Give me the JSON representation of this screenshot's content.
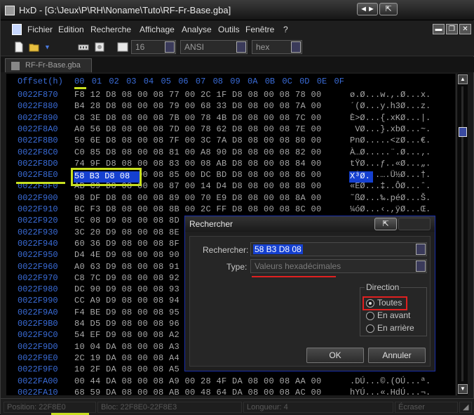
{
  "window": {
    "title": "HxD - [G:\\Jeux\\P\\RH\\Noname\\Tuto\\RF-Fr-Base.gba]",
    "restore_glyph": "◄►",
    "close_glyph": "⇱"
  },
  "menu": {
    "items": [
      "Fichier",
      "Edition",
      "Recherche",
      "Affichage",
      "Analyse",
      "Outils",
      "Fenêtre",
      "?"
    ]
  },
  "toolbar": {
    "bytes_per_row": "16",
    "charset": "ANSI",
    "offset_base": "hex"
  },
  "tab": {
    "label": "RF-Fr-Base.gba"
  },
  "hex": {
    "offset_header": "Offset(h)",
    "columns": [
      "00",
      "01",
      "02",
      "03",
      "04",
      "05",
      "06",
      "07",
      "08",
      "09",
      "0A",
      "0B",
      "0C",
      "0D",
      "0E",
      "0F"
    ],
    "rows": [
      {
        "offset": "0022F870",
        "bytes": "F8 12 D8 08 00 08 77 00 2C 1F D8 08 00 08 78 00",
        "ascii": "ø.Ø...w.,.Ø...x."
      },
      {
        "offset": "0022F880",
        "bytes": "B4 28 D8 08 00 08 79 00 68 33 D8 08 00 08 7A 00",
        "ascii": "´(Ø...y.h3Ø...z."
      },
      {
        "offset": "0022F890",
        "bytes": "C8 3E D8 08 00 08 7B 00 78 4B D8 08 00 08 7C 00",
        "ascii": "È>Ø...{.xKØ...|."
      },
      {
        "offset": "0022F8A0",
        "bytes": "A0 56 D8 08 00 08 7D 00 78 62 D8 08 00 08 7E 00",
        "ascii": " VØ...}.xbØ...~."
      },
      {
        "offset": "0022F8B0",
        "bytes": "50 6E D8 08 00 08 7F 00 3C 7A D8 08 00 08 80 00",
        "ascii": "PnØ.....<zØ...€."
      },
      {
        "offset": "0022F8C0",
        "bytes": "C0 85 D8 08 00 08 81 00 A8 90 D8 08 00 08 82 00",
        "ascii": "À…Ø.....¨.Ø...‚."
      },
      {
        "offset": "0022F8D0",
        "bytes": "74 9F D8 08 00 08 83 00 08 AB D8 08 00 08 84 00",
        "ascii": "tŸØ...ƒ..«Ø...„."
      },
      {
        "offset": "0022F8E0",
        "bytes": "58 B3 D8 08 00 08 85 00 DC BD D8 08 00 08 86 00",
        "ascii": "X³Ø...….Ü½Ø...†."
      },
      {
        "offset": "0022F8F0",
        "bytes": "AB C9 D8 08 00 08 87 00 14 D4 D8 08 00 08 88 00",
        "ascii": "«ÉØ...‡..ÔØ...ˆ."
      },
      {
        "offset": "0022F900",
        "bytes": "98 DF D8 08 00 08 89 00 70 E9 D8 08 00 08 8A 00",
        "ascii": "˜ßØ...‰.péØ...Š."
      },
      {
        "offset": "0022F910",
        "bytes": "BC F3 D8 08 00 08 8B 00 2C FF D8 08 00 08 8C 00",
        "ascii": "¼óØ...‹.,ÿØ...Œ."
      },
      {
        "offset": "0022F920",
        "bytes": "5C 08 D9 08 00 08 8D 00",
        "ascii": ""
      },
      {
        "offset": "0022F930",
        "bytes": "3C 20 D9 08 00 08 8E 00",
        "ascii": ""
      },
      {
        "offset": "0022F940",
        "bytes": "60 36 D9 08 00 08 8F 00",
        "ascii": ""
      },
      {
        "offset": "0022F950",
        "bytes": "D4 4E D9 08 00 08 90 00",
        "ascii": ""
      },
      {
        "offset": "0022F960",
        "bytes": "A0 63 D9 08 00 08 91 00",
        "ascii": ""
      },
      {
        "offset": "0022F970",
        "bytes": "C8 7C D9 08 00 08 92 00",
        "ascii": ""
      },
      {
        "offset": "0022F980",
        "bytes": "DC 90 D9 08 00 08 93 00",
        "ascii": ""
      },
      {
        "offset": "0022F990",
        "bytes": "CC A9 D9 08 00 08 94 00",
        "ascii": ""
      },
      {
        "offset": "0022F9A0",
        "bytes": "F4 BE D9 08 00 08 95 00",
        "ascii": ""
      },
      {
        "offset": "0022F9B0",
        "bytes": "84 D5 D9 08 00 08 96 00",
        "ascii": ""
      },
      {
        "offset": "0022F9C0",
        "bytes": "54 EF D9 08 00 08 A2 00",
        "ascii": ""
      },
      {
        "offset": "0022F9D0",
        "bytes": "10 04 DA 08 00 08 A3 00",
        "ascii": ""
      },
      {
        "offset": "0022F9E0",
        "bytes": "2C 19 DA 08 00 08 A4 00",
        "ascii": ""
      },
      {
        "offset": "0022F9F0",
        "bytes": "10 2F DA 08 00 08 A5 00",
        "ascii": ""
      },
      {
        "offset": "0022FA00",
        "bytes": "00 44 DA 08 00 08 A9 00 28 4F DA 08 00 08 AA 00",
        "ascii": ".DÚ...©.(OÚ...ª."
      },
      {
        "offset": "0022FA10",
        "bytes": "68 59 DA 08 00 08 AB 00 48 64 DA 08 00 08 AC 00",
        "ascii": "hYÚ...«.HdÚ...¬."
      }
    ],
    "selected_bytes": "58 B3 D8 08",
    "selected_ascii": "X³Ø."
  },
  "status": {
    "position": "Position: 22F8E0",
    "block": "Bloc: 22F8E0-22F8E3",
    "length": "Longueur: 4",
    "mode": "Écraser"
  },
  "dialog": {
    "title": "Rechercher",
    "close_glyph": "⇱",
    "search_label": "Rechercher:",
    "search_value": "58 B3 D8 08",
    "type_label": "Type:",
    "type_value": "Valeurs hexadécimales",
    "direction_label": "Direction",
    "direction_options": [
      "Toutes",
      "En avant",
      "En arrière"
    ],
    "direction_selected": "Toutes",
    "ok_label": "OK",
    "cancel_label": "Annuler"
  },
  "colors": {
    "offset_blue": "#3a6cd8",
    "selection_blue": "#1540d0",
    "annotation_green": "#c8e020",
    "annotation_red": "#e02020"
  }
}
